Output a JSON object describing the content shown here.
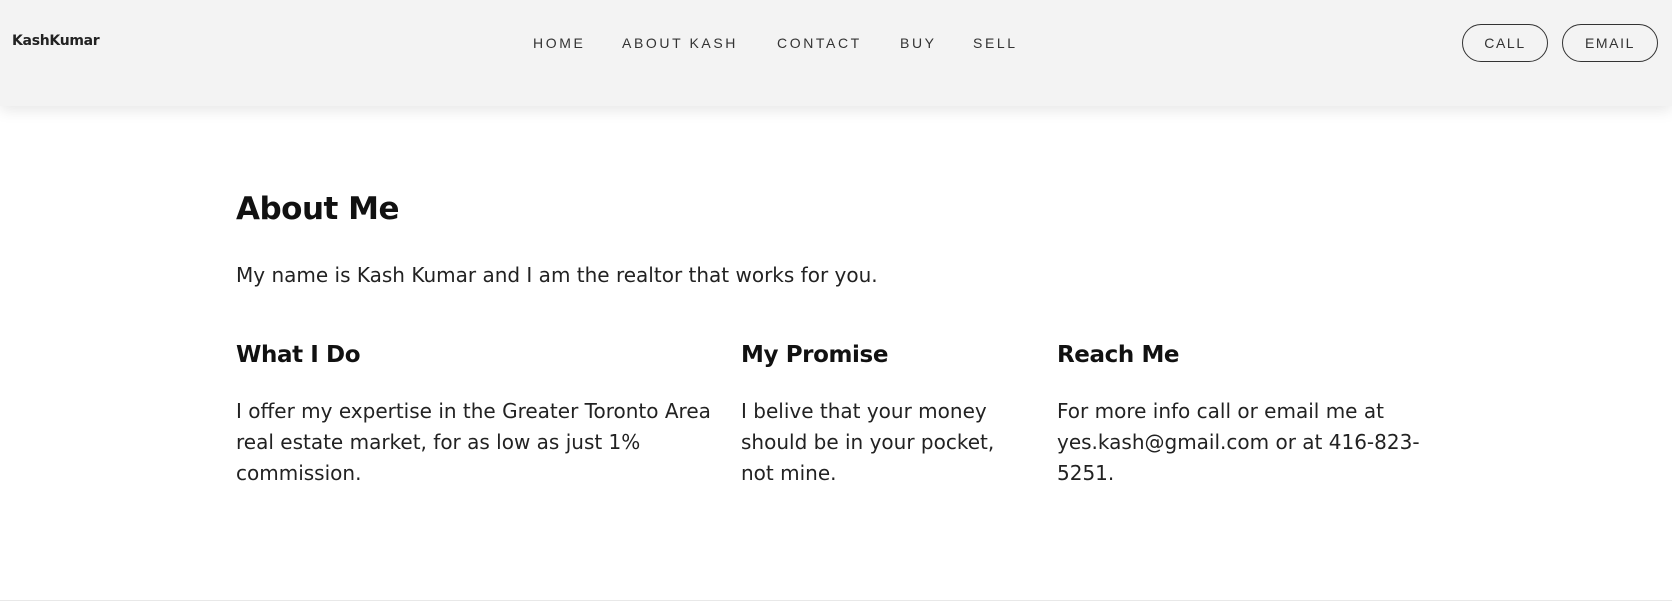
{
  "header": {
    "brand": "KashKumar",
    "nav": [
      {
        "label": "HOME"
      },
      {
        "label": "ABOUT KASH"
      },
      {
        "label": "CONTACT"
      },
      {
        "label": "BUY"
      },
      {
        "label": "SELL"
      }
    ],
    "buttons": {
      "call_label": "CALL",
      "email_label": "EMAIL"
    }
  },
  "main": {
    "title": "About Me",
    "intro": "My name is Kash Kumar and I am the realtor that works for you.",
    "columns": [
      {
        "heading": "What I Do",
        "text": "I offer my expertise in the Greater Toronto Area real estate market, for as low as just 1% commission."
      },
      {
        "heading": "My Promise",
        "text": "I belive that your money should be in your pocket, not mine."
      },
      {
        "heading": "Reach Me",
        "text": "For more info call or email me at yes.kash@gmail.com or at 416-823-5251."
      }
    ]
  },
  "colors": {
    "header_bg": "#f3f3f3",
    "text": "#222222",
    "heading": "#111111",
    "page_bg": "#ffffff"
  }
}
